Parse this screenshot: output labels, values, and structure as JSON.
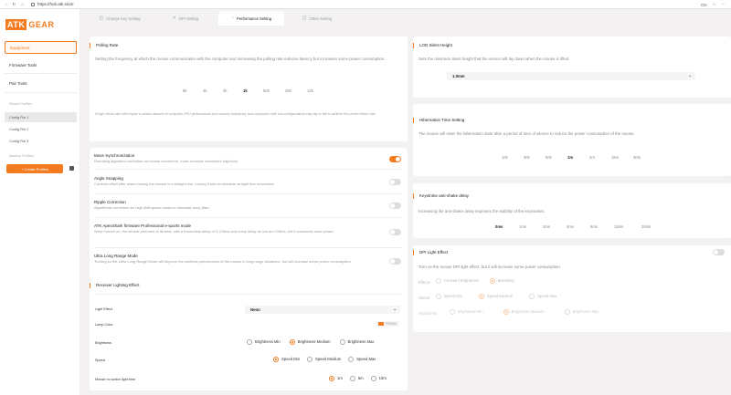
{
  "browser": {
    "url": "https://hub.atk.store",
    "extra": "CN"
  },
  "brand": {
    "badge": "ATK",
    "word": "GEAR"
  },
  "sidebar": {
    "equipment": "Equipment",
    "firmware_tools": "Firmware Tools",
    "pair_tools": "Pair Tools",
    "stored_profiles": "Stored Profiles",
    "configs": [
      "Config File 1",
      "Config File 2",
      "Config File 3"
    ],
    "inactive_profiles": "Inactive Profiles",
    "create_button": "+ Create Profiles"
  },
  "tabs": [
    {
      "label": "Change Key Setting",
      "icon": "◫"
    },
    {
      "label": "DPI Setting",
      "icon": "✕"
    },
    {
      "label": "Performance Setting",
      "icon": "◔"
    },
    {
      "label": "Other Setting",
      "icon": "◫"
    }
  ],
  "polling": {
    "title": "Polling Rate",
    "desc": "Setting the frequency at which the mouse communicates with the computer and increasing the polling rate reduces latency but increases some power consumption.",
    "options": [
      "8k",
      "4k",
      "2k",
      "1k",
      "500",
      "250",
      "125"
    ],
    "selected": "1k",
    "note": "A high return rate will require a certain amount of computer CPU performance and memory frequency, and computers with low configurations may lag or fail to achieve the preset return rate."
  },
  "switches": [
    {
      "title": "Move Synchronization",
      "desc": "Rounding algorithm correction for mouse movement, more accurate movement trajectory.",
      "on": true
    },
    {
      "title": "Angle Snapping",
      "desc": "Corrects offset jitter when moving the mouse in a straight line, turning it into an absolute straight line movement.",
      "on": false
    },
    {
      "title": "Ripple Correction",
      "desc": "Algorithmic correction for high shift speed cases to eliminate wavy jitter.",
      "on": false
    },
    {
      "title": "ATK ApexShark firmware Professional e-sports mode",
      "desc": "When turned on, the sensor performs at its best, with a theoretical delay of 0.125ms and a key delay as low as 0.09ms, but it consumes more power.",
      "on": false
    },
    {
      "title": "Ultra Long Range Mode",
      "desc": "Turning on the Ultra Long Range Mode will improve the wireless performance of the mouse in long range situations, but will increase some power consumption.",
      "on": false
    }
  ],
  "receiver": {
    "title": "Receiver Lighting Effect",
    "light_effect_label": "Light Effect",
    "light_effect_value": "Neon",
    "lamp_color_label": "Lamp Color",
    "lamp_color_value": "FF5300",
    "brightness_label": "Brightness",
    "brightness_options": [
      "Brightness Min",
      "Brightness Medium",
      "Brightness Max"
    ],
    "speed_label": "Speed",
    "speed_options": [
      "Speed Min",
      "Speed Medium",
      "Speed Max"
    ],
    "noaction_label": "Mouse no action light time",
    "noaction_options": [
      "1m",
      "5m",
      "10m"
    ]
  },
  "lod": {
    "title": "LOD Silent Height",
    "desc": "Sets the minimum silent height that the sensor will lay down when the mouse is lifted.",
    "value": "1.0mm"
  },
  "hibernation": {
    "title": "Hibernation Time Setting",
    "desc": "The mouse will enter the hibernation state after a period of time of silence to reduce the power consumption of the mouse.",
    "options": [
      "10s",
      "30s",
      "50s",
      "1m",
      "2m",
      "15m",
      "30m"
    ],
    "selected": "1m"
  },
  "antishake": {
    "title": "Keystroke anti-shake delay",
    "desc": "Increasing the anti-shake delay improves the stability of the keystrokes.",
    "options": [
      "0ms",
      "1ms",
      "2ms",
      "4ms",
      "8ms",
      "15ms",
      "20ms"
    ],
    "selected": "0ms"
  },
  "dpi_light": {
    "title": "DPI Light Effect",
    "desc": "Turn on the mouse DPI light effect, but it will increase some power consumption.",
    "effects_label": "Effects",
    "effects_options": [
      "Constant Brightness",
      "Breathing"
    ],
    "speed_label": "Speed",
    "speed_options": [
      "Speed Min",
      "Speed Medium",
      "Speed Max"
    ],
    "brightness_label": "Brightness",
    "brightness_options": [
      "Brightness Min",
      "Brightness Medium",
      "Brightness Max"
    ]
  },
  "colors": {
    "accent": "#f47b20"
  }
}
